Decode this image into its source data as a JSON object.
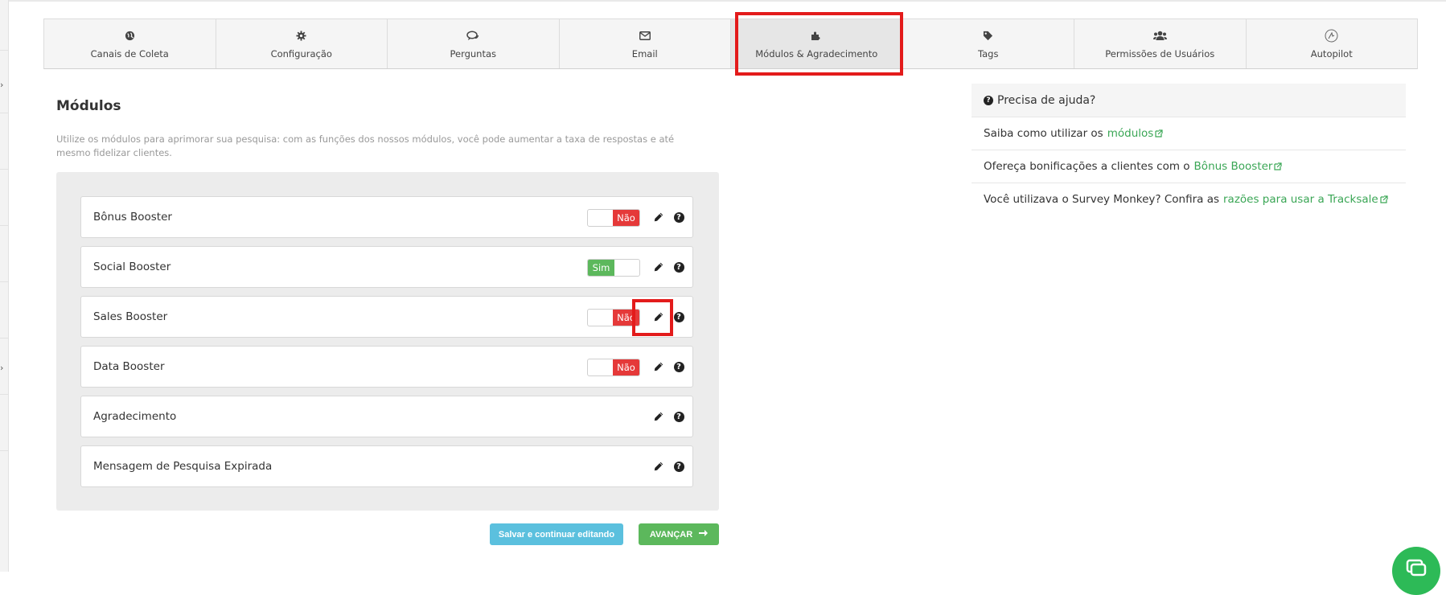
{
  "tabs": [
    {
      "label": "Canais de Coleta",
      "icon": "globe-icon"
    },
    {
      "label": "Configuração",
      "icon": "gear-icon"
    },
    {
      "label": "Perguntas",
      "icon": "chat-bubbles-icon"
    },
    {
      "label": "Email",
      "icon": "envelope-icon"
    },
    {
      "label": "Módulos & Agradecimento",
      "icon": "puzzle-icon",
      "active": true
    },
    {
      "label": "Tags",
      "icon": "tag-icon"
    },
    {
      "label": "Permissões de Usuários",
      "icon": "users-icon"
    },
    {
      "label": "Autopilot",
      "icon": "autopilot-icon"
    }
  ],
  "main": {
    "title": "Módulos",
    "description": "Utilize os módulos para aprimorar sua pesquisa: com as funções dos nossos módulos, você pode aumentar a taxa de respostas e até mesmo fidelizar clientes."
  },
  "modules": [
    {
      "name": "Bônus Booster",
      "toggle": "Não",
      "enabled": false
    },
    {
      "name": "Social Booster",
      "toggle": "Sim",
      "enabled": true
    },
    {
      "name": "Sales Booster",
      "toggle": "Não",
      "enabled": false
    },
    {
      "name": "Data Booster",
      "toggle": "Não",
      "enabled": false
    },
    {
      "name": "Agradecimento"
    },
    {
      "name": "Mensagem de Pesquisa Expirada"
    }
  ],
  "actions": {
    "save_label": "Salvar e continuar editando",
    "next_label": "AVANÇAR"
  },
  "help": {
    "header": "Precisa de ajuda?",
    "items": [
      {
        "text": "Saiba como utilizar os",
        "link": "módulos"
      },
      {
        "text": "Ofereça bonificações a clientes com o",
        "link": "Bônus Booster"
      },
      {
        "text": "Você utilizava o Survey Monkey? Confira as",
        "link": "razões para usar a Tracksale"
      }
    ]
  },
  "colors": {
    "off": "#e53939",
    "on": "#5cb85c",
    "link": "#3aa655",
    "highlight": "#e31b1b",
    "save_button": "#5bc0de"
  }
}
